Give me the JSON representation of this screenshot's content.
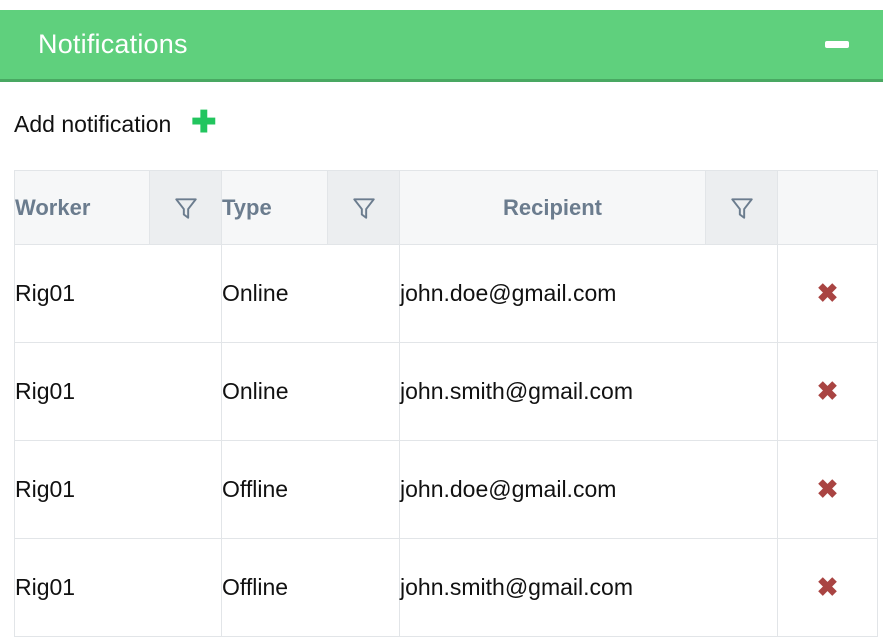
{
  "panel": {
    "title": "Notifications",
    "header_color": "#5fd07d",
    "minimize_icon": "minimize-icon"
  },
  "add": {
    "label": "Add notification",
    "plus_icon": "plus-icon",
    "plus_color": "#22c55e"
  },
  "table": {
    "columns": [
      {
        "label": "Worker",
        "filter_icon": "filter-icon"
      },
      {
        "label": "Type",
        "filter_icon": "filter-icon"
      },
      {
        "label": "Recipient",
        "filter_icon": "filter-icon"
      },
      {
        "label": ""
      }
    ],
    "delete_icon": "✖",
    "delete_color": "#a94442",
    "rows": [
      {
        "worker": "Rig01",
        "type": "Online",
        "recipient": "john.doe@gmail.com"
      },
      {
        "worker": "Rig01",
        "type": "Online",
        "recipient": "john.smith@gmail.com"
      },
      {
        "worker": "Rig01",
        "type": "Offline",
        "recipient": "john.doe@gmail.com"
      },
      {
        "worker": "Rig01",
        "type": "Offline",
        "recipient": "john.smith@gmail.com"
      }
    ]
  }
}
